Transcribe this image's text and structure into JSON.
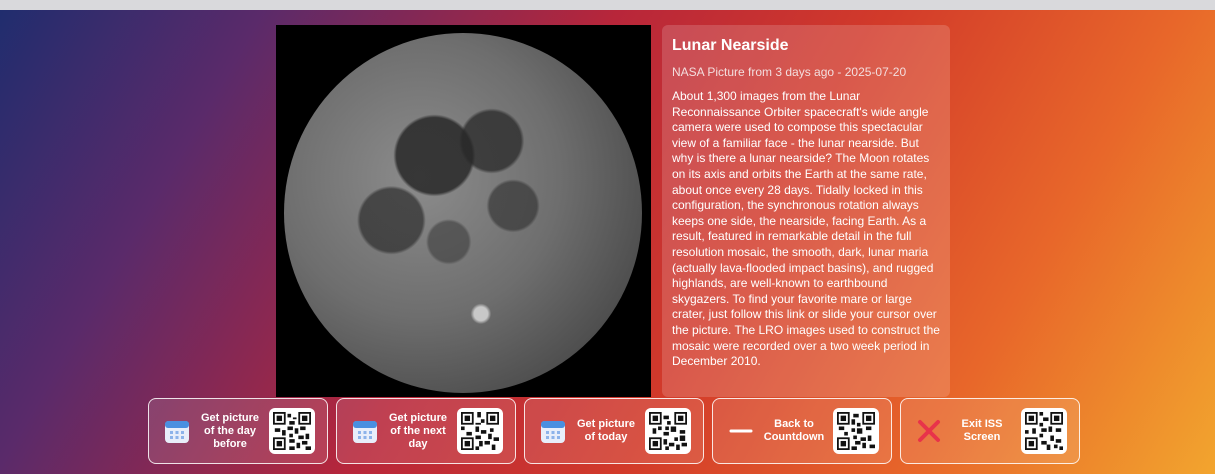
{
  "apod": {
    "title": "Lunar Nearside",
    "subtitle": "NASA Picture from 3 days ago - 2025-07-20",
    "description": "About 1,300 images from the Lunar Reconnaissance Orbiter spacecraft's wide angle camera were used to compose this spectacular view of a familiar face - the lunar nearside. But why is there a lunar nearside? The Moon rotates on its axis and orbits the Earth at the same rate, about once every 28 days. Tidally locked in this configuration, the synchronous rotation always keeps one side, the nearside, facing Earth. As a result, featured in remarkable detail in the full resolution mosaic, the smooth, dark, lunar maria (actually lava-flooded impact basins), and rugged highlands, are well-known to earthbound skygazers. To find your favorite mare or large crater, just follow this link or slide your cursor over the picture. The LRO images used to construct the mosaic were recorded over a two week period in December 2010."
  },
  "buttons": [
    {
      "label": "Get picture of the day before",
      "icon": "calendar-icon"
    },
    {
      "label": "Get picture of the next day",
      "icon": "calendar-icon"
    },
    {
      "label": "Get picture of today",
      "icon": "calendar-icon"
    },
    {
      "label": "Back to Countdown",
      "icon": "arrow-left-icon"
    },
    {
      "label": "Exit ISS Screen",
      "icon": "close-icon"
    }
  ],
  "colors": {
    "calendar_blue": "#4a8fe0",
    "exit_red": "#e8334a"
  }
}
